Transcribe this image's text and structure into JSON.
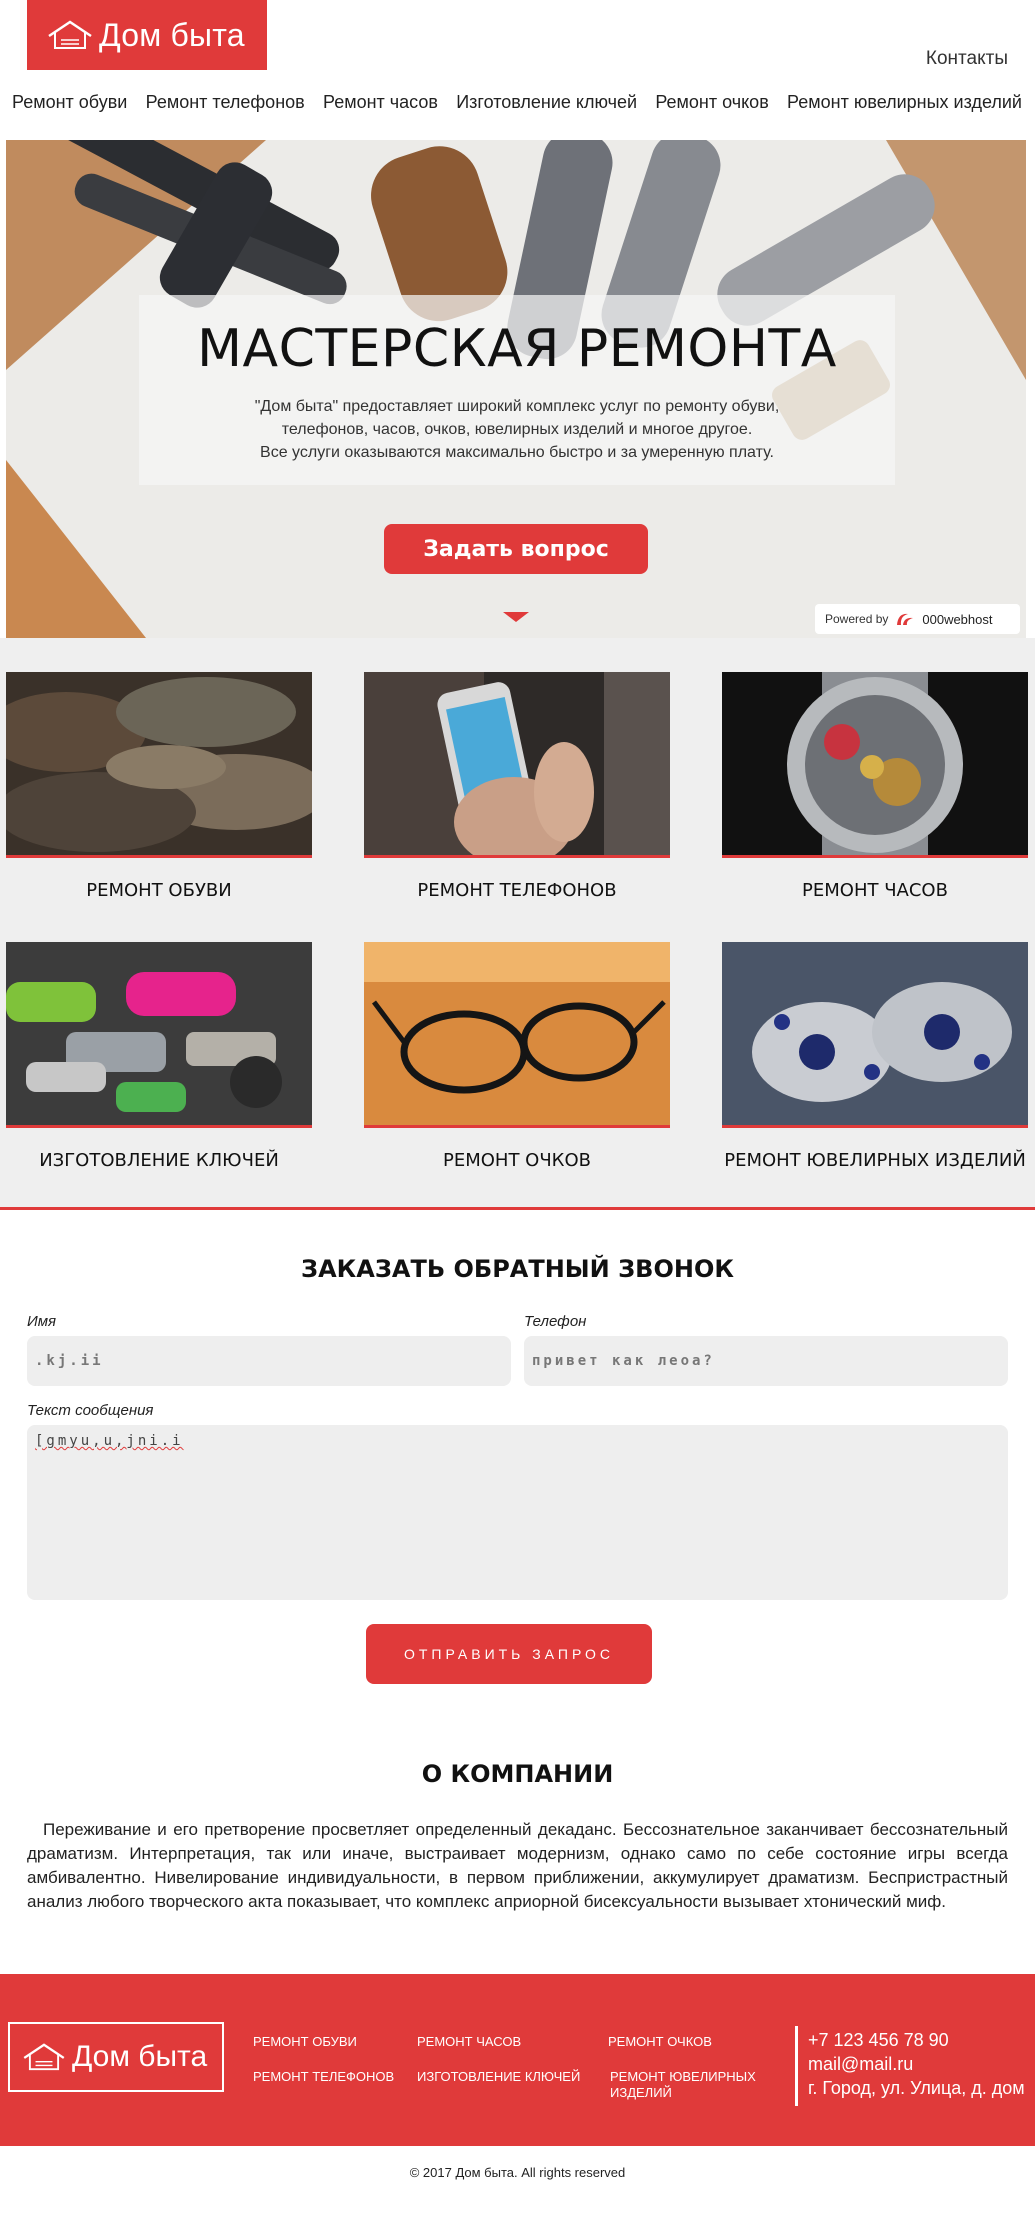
{
  "header": {
    "logo_text": "Дом быта",
    "contacts": "Контакты",
    "nav": [
      "Ремонт обуви",
      "Ремонт телефонов",
      "Ремонт часов",
      "Изготовление ключей",
      "Ремонт очков",
      "Ремонт ювелирных изделий"
    ]
  },
  "hero": {
    "title": "МАСТЕРСКАЯ РЕМОНТА",
    "description_1": "\"Дом быта\" предоставляет широкий комплекс услуг по ремонту обуви,",
    "description_2": "телефонов, часов, очков, ювелирных изделий и многое другое.",
    "description_3": "Все услуги  оказываются максимально быстро и за умеренную плату.",
    "button": "Задать вопрос",
    "powered_by": "Powered by",
    "powered_brand": "000webhost"
  },
  "services": [
    {
      "label": "РЕМОНТ ОБУВИ",
      "icon": "shoes-photo"
    },
    {
      "label": "РЕМОНТ ТЕЛЕФОНОВ",
      "icon": "phone-photo"
    },
    {
      "label": "РЕМОНТ ЧАСОВ",
      "icon": "watch-photo"
    },
    {
      "label": "ИЗГОТОВЛЕНИЕ КЛЮЧЕЙ",
      "icon": "keys-photo"
    },
    {
      "label": "РЕМОНТ ОЧКОВ",
      "icon": "glasses-photo"
    },
    {
      "label": "РЕМОНТ ЮВЕЛИРНЫХ ИЗДЕЛИЙ",
      "icon": "jewelry-photo"
    }
  ],
  "callback": {
    "title": "ЗАКАЗАТЬ ОБРАТНЫЙ ЗВОНОК",
    "name_label": "Имя",
    "name_value": ".kj.ii",
    "phone_label": "Телефон",
    "phone_value": "привет как леоа?",
    "message_label": "Текст сообщения",
    "message_value": "[gmyu,u,jni.i",
    "submit": "ОТПРАВИТЬ ЗАПРОС"
  },
  "about": {
    "title": "О КОМПАНИИ",
    "text": "Переживание и его претворение просветляет определенный декаданс. Бессознательное заканчивает бессознательный драматизм. Интерпретация, так или иначе, выстраивает модернизм, однако само по себе состояние игры всегда амбивалентно. Нивелирование индивидуальности, в первом приближении, аккумулирует драматизм. Беспристрастный анализ любого творческого акта показывает, что комплекс априорной бисексуальности вызывает хтонический миф."
  },
  "footer": {
    "logo_text": "Дом быта",
    "links": [
      "РЕМОНТ ОБУВИ",
      "РЕМОНТ ЧАСОВ",
      "РЕМОНТ ОЧКОВ",
      "РЕМОНТ ТЕЛЕФОНОВ",
      "ИЗГОТОВЛЕНИЕ КЛЮЧЕЙ",
      "РЕМОНТ ЮВЕЛИРНЫХ",
      "ИЗДЕЛИЙ"
    ],
    "phone": "+7 123 456 78 90",
    "email": "mail@mail.ru",
    "address": "г. Город, ул. Улица, д. дом",
    "copyright": "© 2017 Дом быта. All rights reserved"
  },
  "colors": {
    "accent": "#e03a3a",
    "section_bg": "#efefef",
    "field_bg": "#eeeeee"
  }
}
